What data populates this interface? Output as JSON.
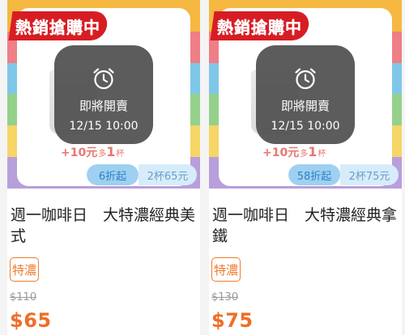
{
  "colors": {
    "banner_red": "#d71d24",
    "price_orange": "#ef6e28",
    "tag_orange": "#ef7b2c",
    "promo_pink": "#e8766f",
    "pill_blue": "#9fd0f1",
    "pill_light": "#d7ecfa"
  },
  "frame_stripes": [
    "#f5b841",
    "#ef7e86",
    "#7fc7e8",
    "#95d18a",
    "#f7d566",
    "#b79fdc"
  ],
  "products": [
    {
      "hot_banner": "熱銷搶購中",
      "coming_soon_label": "即將開賣",
      "start_time": "12/15 10:00",
      "promo_amount": "+10元",
      "promo_many": "多",
      "promo_one": "1",
      "promo_cup": "杯",
      "discount_label": "6折起",
      "bundle_label": "2杯65元",
      "title": "週一咖啡日　大特濃經典美式",
      "tag": "特濃",
      "original_price": "$110",
      "sale_price": "$65"
    },
    {
      "hot_banner": "熱銷搶購中",
      "coming_soon_label": "即將開賣",
      "start_time": "12/15 10:00",
      "promo_amount": "+10元",
      "promo_many": "多",
      "promo_one": "1",
      "promo_cup": "杯",
      "discount_label": "58折起",
      "bundle_label": "2杯75元",
      "title": "週一咖啡日　大特濃經典拿鐵",
      "tag": "特濃",
      "original_price": "$130",
      "sale_price": "$75"
    }
  ]
}
